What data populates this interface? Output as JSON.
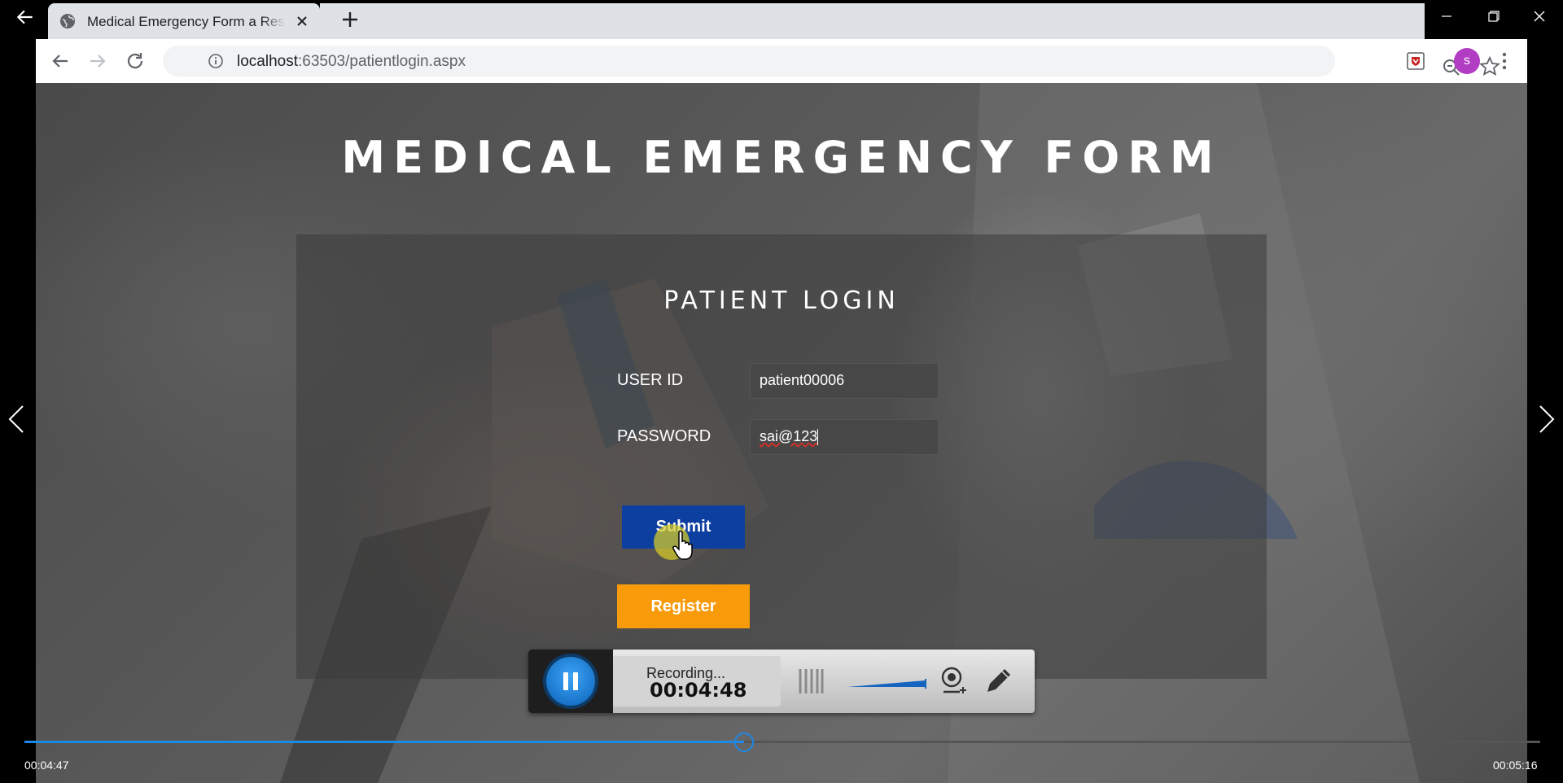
{
  "browser": {
    "tab": {
      "title": "Medical Emergency Form a Responsive Widget Flat Bootstrap"
    },
    "address": {
      "host": "localhost",
      "path": ":63503/patientlogin.aspx"
    },
    "profile_initial": "s"
  },
  "page": {
    "title": "MEDICAL EMERGENCY FORM",
    "login": {
      "heading": "PATIENT LOGIN",
      "user_id_label": "USER ID",
      "user_id_value": "patient00006",
      "password_label": "PASSWORD",
      "password_value": "sai@123",
      "submit_label": "Submit",
      "register_label": "Register"
    }
  },
  "recorder": {
    "status": "Recording...",
    "elapsed": "00:04:48"
  },
  "player": {
    "current_time": "00:04:47",
    "total_time": "00:05:16",
    "progress": 0.475
  },
  "colors": {
    "submit": "#0d3fa0",
    "register": "#f89a0a",
    "accent": "#1e88e5",
    "profile": "#b13dc2"
  }
}
